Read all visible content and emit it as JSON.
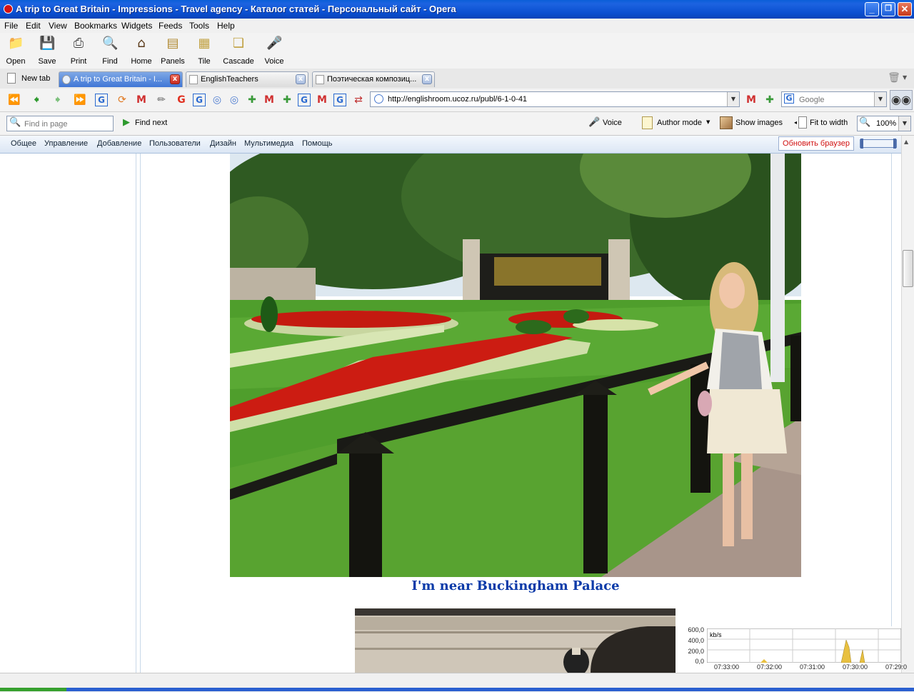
{
  "window": {
    "title": "A trip to Great Britain - Impressions - Travel agency - Каталог статей - Персональный сайт - Opera",
    "controls": {
      "minimize": "_",
      "maximize": "❐",
      "close": "✕"
    }
  },
  "menu": [
    "File",
    "Edit",
    "View",
    "Bookmarks",
    "Widgets",
    "Feeds",
    "Tools",
    "Help"
  ],
  "toolbar": [
    "Open",
    "Save",
    "Print",
    "Find",
    "Home",
    "Panels",
    "Tile",
    "Cascade",
    "Voice"
  ],
  "tabs": {
    "new_tab": "New tab",
    "items": [
      {
        "label": "A trip to Great Britain - I...",
        "active": true
      },
      {
        "label": "EnglishTeachers",
        "active": false
      },
      {
        "label": "Поэтическая композиц...",
        "active": false
      }
    ]
  },
  "address": {
    "url": "http://englishroom.ucoz.ru/publ/6-1-0-41",
    "search_placeholder": "Google"
  },
  "findbar": {
    "placeholder": "Find in page",
    "find_next": "Find next",
    "voice": "Voice",
    "author_mode": "Author mode",
    "show_images": "Show images",
    "fit_to_width": "Fit to width",
    "zoom": "100%"
  },
  "site_nav": {
    "items": [
      "Общее",
      "Управление",
      "Добавление",
      "Пользователи",
      "Дизайн",
      "Мультимедиа",
      "Помощь"
    ],
    "update_button": "Обновить браузер"
  },
  "content": {
    "caption": "I'm near Buckingham Palace"
  },
  "traffic": {
    "unit": "kb/s",
    "y_labels": [
      "600,0",
      "400,0",
      "200,0",
      "0,0"
    ],
    "x_labels": [
      "07:33:00",
      "07:32:00",
      "07:31:00",
      "07:30:00",
      "07:29:0"
    ]
  },
  "colors": {
    "accent": "#0a5ed8",
    "caption": "#0a3aa8",
    "update_text": "#d01010"
  }
}
